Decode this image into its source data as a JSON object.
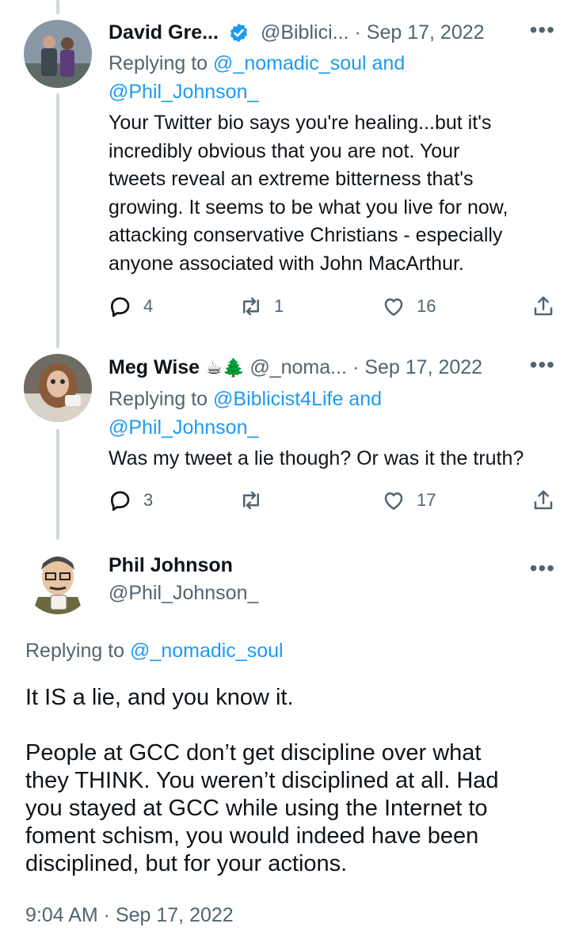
{
  "tweets": [
    {
      "name": "David Gre...",
      "handle": "@Biblici...",
      "date": "Sep 17, 2022",
      "reply_prefix": "Replying to",
      "reply_line1": "@_nomadic_soul and",
      "reply_line2": "@Phil_Johnson_",
      "text": "Your Twitter bio says you're healing...but it's\nincredibly obvious that you are not. Your\ntweets reveal an extreme bitterness that's\ngrowing. It seems to be what you live for now,\nattacking conservative Christians - especially\nanyone associated with John MacArthur.",
      "replies": "4",
      "retweets": "1",
      "likes": "16"
    },
    {
      "name": "Meg Wise",
      "emoji": "☕🌲",
      "handle": "@_noma...",
      "date": "Sep 17, 2022",
      "reply_prefix": "Replying to",
      "reply_line1": "@Biblicist4Life and",
      "reply_line2": "@Phil_Johnson_",
      "text": "Was my tweet a lie though? Or was it the truth?",
      "replies": "3",
      "retweets": "",
      "likes": "17"
    }
  ],
  "main": {
    "name": "Phil Johnson",
    "handle": "@Phil_Johnson_",
    "reply_prefix": "Replying to",
    "reply_mention": "@_nomadic_soul",
    "text": "It IS a lie, and you know it.\n\nPeople at GCC don’t get discipline over what\nthey THINK. You weren’t disciplined at all. Had\nyou stayed at GCC while using the Internet to\nfoment schism, you would indeed have been\ndisciplined, but for your actions.",
    "timestamp": "9:04 AM · Sep 17, 2022"
  },
  "ui": {
    "more": "•••",
    "dot": "·",
    "verified_color": "#1d9bf0",
    "link_color": "#1d9bf0",
    "secondary_color": "#536471"
  }
}
